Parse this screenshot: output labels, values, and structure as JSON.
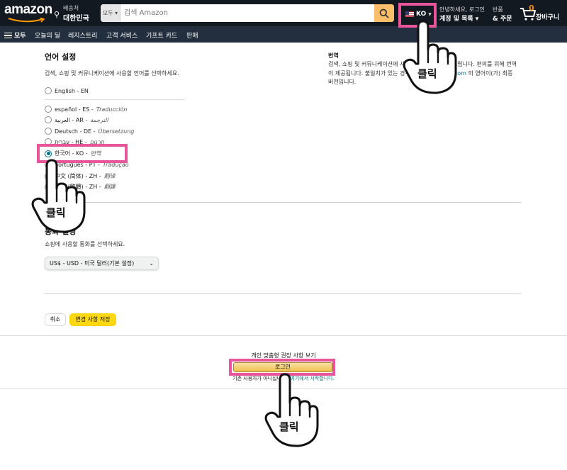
{
  "header": {
    "logo": "amazon",
    "deliver_line1": "배송처",
    "deliver_line2": "대한민국",
    "search_category": "모두 ▾",
    "search_placeholder": "검색 Amazon",
    "language_code": "KO",
    "account_line1": "안녕하세요, 로그인",
    "account_line2": "계정 및 목록 ▾",
    "returns_line1": "반품",
    "returns_line2": "& 주문",
    "cart_count": "0",
    "cart_label": "장바구니"
  },
  "subnav": {
    "all": "모두",
    "items": [
      "오늘의 딜",
      "레지스트리",
      "고객 서비스",
      "기프트 카드",
      "판매"
    ]
  },
  "language_settings": {
    "heading": "언어 설정",
    "description": "검색, 쇼핑 및 커뮤니케이션에 사용할 언어를 선택하세요.",
    "options": [
      {
        "label": "English - EN",
        "note": "",
        "checked": false
      },
      {
        "label": "español - ES - ",
        "note": "Traducción",
        "checked": false
      },
      {
        "label": "العربية - AR - ",
        "note": "الترجمة",
        "checked": false
      },
      {
        "label": "Deutsch - DE - ",
        "note": "Übersetzung",
        "checked": false
      },
      {
        "label": "עברית - HE - ",
        "note": "תרגום",
        "checked": false
      },
      {
        "label": "한국어 - KO - ",
        "note": "번역",
        "checked": true
      },
      {
        "label": "português - PT - ",
        "note": "Tradução",
        "checked": false
      },
      {
        "label": "中文 (简体) - ZH - ",
        "note": "翻译",
        "checked": false
      },
      {
        "label": "中文 (繁體) - ZH - ",
        "note": "翻譯",
        "checked": false
      }
    ]
  },
  "translation": {
    "heading": "번역",
    "text": "검색, 쇼핑 및 커뮤니케이션에 사용할 정보를 번역해 드립니다. 편의를 위해 번역이 제공됩니다. 불일치가 있는 경우 비롯한",
    "link": "Amazon.com",
    "text_end": "의 영어이(가) 최종 버전입니다."
  },
  "currency_settings": {
    "heading": "통화 설정",
    "description": "쇼핑에 사용할 통화를 선택하세요.",
    "selected": "US$ - USD - 미국 달러(기본 설정)"
  },
  "actions": {
    "cancel": "취소",
    "save": "변경 사항 저장"
  },
  "footer": {
    "recommendations": "개인 맞춤형 권장 사항 보기",
    "login": "로그인",
    "new_customer": "기존 사용자가 아니십니까?",
    "new_customer_link": "여기에서 시작합니다."
  },
  "overlay": {
    "click_label": "클릭",
    "highlight_color": "#e8559b"
  }
}
